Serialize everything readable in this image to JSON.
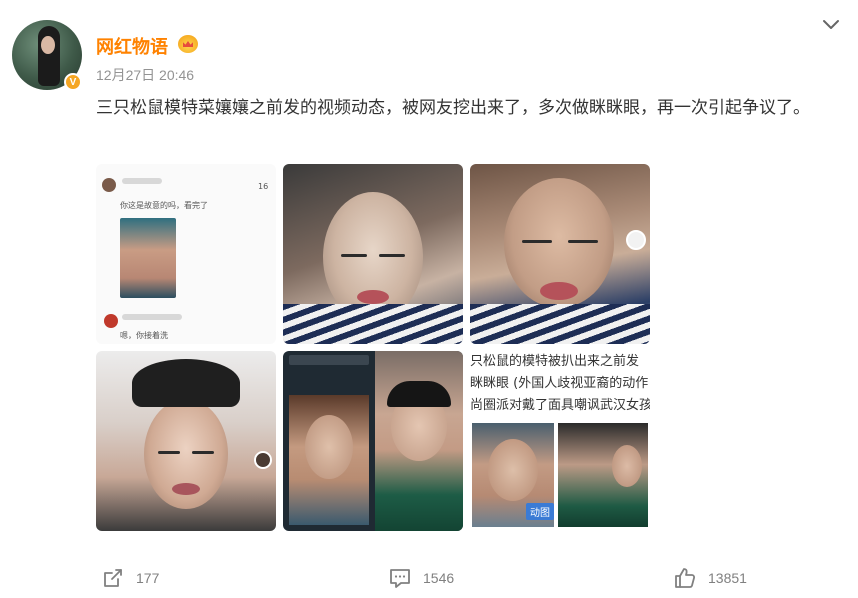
{
  "post": {
    "username": "网红物语",
    "timestamp": "12月27日 20:46",
    "verified_badge": "V",
    "text": "三只松鼠模特菜孃孃之前发的视频动态，被网友挖出来了，多次做眯眯眼，再一次引起争议了。"
  },
  "images": {
    "tile1": {
      "comment1": "你这是故意的吗，看完了",
      "comment2": "嗯，你接着洗",
      "count": "16"
    },
    "tile6": {
      "line1": "只松鼠的模特被扒出来之前发",
      "line2": "眯眯眼 (外国人歧视亚裔的动作",
      "line3": "尚圈派对戴了面具嘲讽武汉女孩",
      "gif_label": "动图"
    }
  },
  "actions": {
    "repost_count": "177",
    "comment_count": "1546",
    "like_count": "13851"
  },
  "colors": {
    "username": "#ff8200",
    "timestamp": "#939393",
    "text": "#333333",
    "action": "#808080"
  },
  "icons": [
    "chevron-down-icon",
    "crown-icon",
    "verified-icon",
    "repost-icon",
    "comment-icon",
    "like-icon"
  ]
}
